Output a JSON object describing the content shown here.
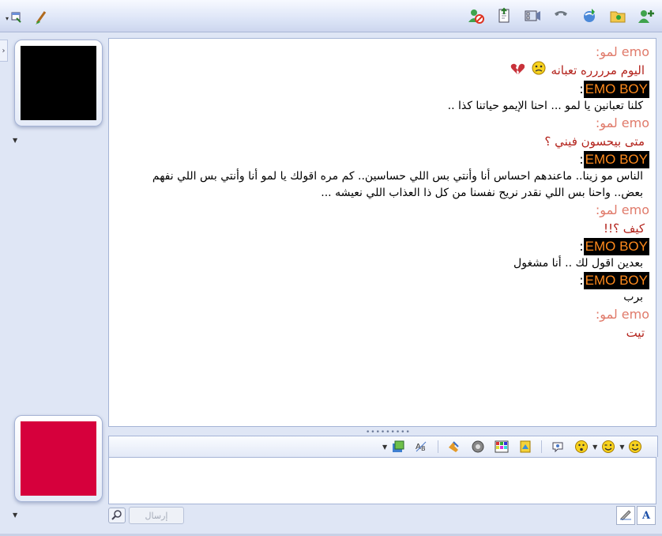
{
  "toolbar": {
    "left_icons": [
      "window-menu-icon",
      "paint-brush-icon"
    ],
    "right_icons": [
      "block-contact-icon",
      "send-files-icon",
      "webcam-icon",
      "voice-call-icon",
      "share-icon",
      "games-folder-icon",
      "add-contact-icon"
    ]
  },
  "conversation": [
    {
      "sender": "emo",
      "sender_label": "emo لمو:",
      "text": "اليوم مرررره تعبانه",
      "emoticons": [
        "sad-face-icon",
        "broken-heart-icon"
      ]
    },
    {
      "sender": "boy",
      "sender_label": "EMO BOY",
      "text": "كلنا تعبانين يا لمو ... احنا الإيمو حياتنا كذا .."
    },
    {
      "sender": "emo",
      "sender_label": "emo لمو:",
      "text": "متى بيحسون فيني ؟"
    },
    {
      "sender": "boy",
      "sender_label": "EMO BOY",
      "text": "الناس مو زينا.. ماعندهم احساس أنا وأنتي بس اللي حساسين.. كم مره اقولك يا لمو أنا وأنتي بس اللي نفهم بعض.. واحنا بس اللي نقدر نريح نفسنا من كل ذا العذاب اللي نعيشه ..."
    },
    {
      "sender": "emo",
      "sender_label": "emo لمو:",
      "text": "كيف ؟!!"
    },
    {
      "sender": "boy",
      "sender_label": "EMO BOY",
      "text": "بعدين اقول لك .. أنا مشغول"
    },
    {
      "sender": "boy",
      "sender_label": "EMO BOY",
      "text": "برب"
    },
    {
      "sender": "emo",
      "sender_label": "emo لمو:",
      "text": "تيت"
    }
  ],
  "compose": {
    "send_label": "إرسال",
    "input_value": "",
    "font_button_label": "A"
  },
  "colors": {
    "emo_sender": "#e07a6a",
    "emo_text": "#b3221b",
    "boy_label_bg": "#000000",
    "boy_label_fg": "#ff8a1c",
    "top_avatar": "#000000",
    "bottom_avatar": "#d6003c"
  }
}
